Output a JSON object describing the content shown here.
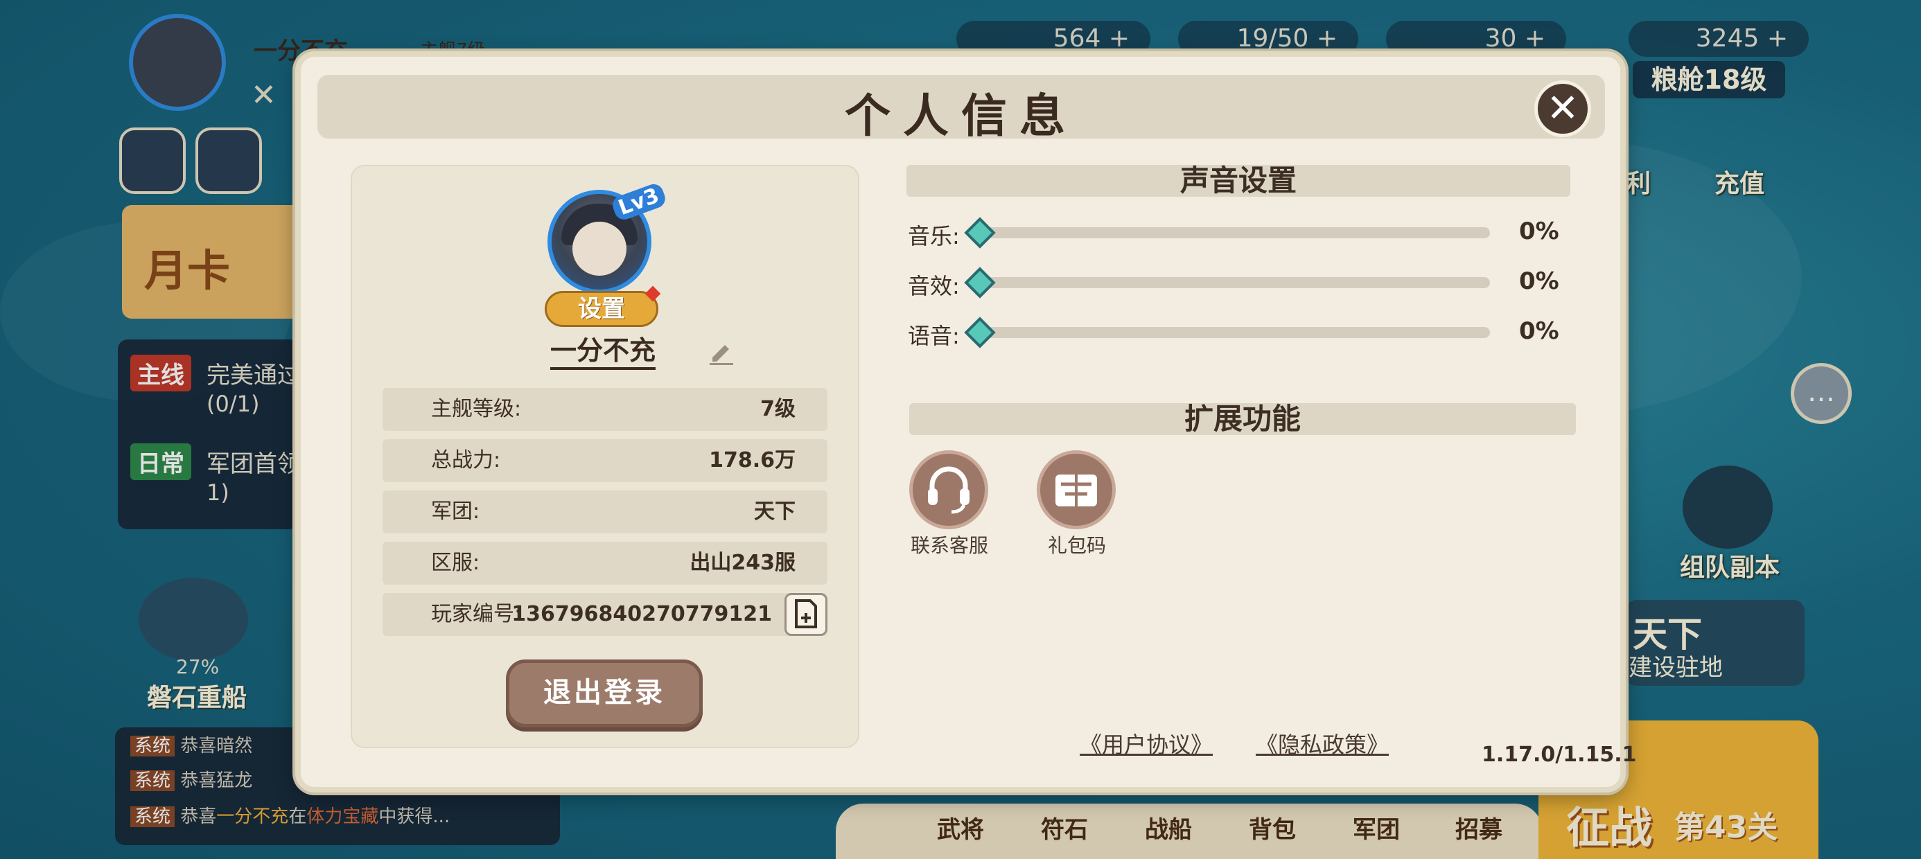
{
  "background": {
    "player_name": "一分不充",
    "rank_text": "主舰7级",
    "hud": {
      "coins": "564 +",
      "stamina": "19/50 +",
      "gold": "30 +",
      "grain": "3245 +",
      "granary": "粮舱18级"
    },
    "side_labels": {
      "welfare": "利",
      "recharge": "充值",
      "team_dungeon": "组队副本",
      "tianxia": "天下",
      "build_base": "建设驻地"
    },
    "month_card": "月卡",
    "quests": [
      {
        "tag": "主线",
        "text": "完美通过",
        "progress": "(0/1)"
      },
      {
        "tag": "日常",
        "text": "军团首领",
        "progress": "1)"
      }
    ],
    "ship": {
      "percent": "27%",
      "name": "磐石重船"
    },
    "chat": [
      {
        "tag": "系统",
        "text": "恭喜暗然"
      },
      {
        "tag": "系统",
        "text": "恭喜猛龙"
      },
      {
        "tag": "系统",
        "prefix": "恭喜",
        "name": "一分不充",
        "mid": "在",
        "place": "体力宝藏",
        "suffix": "中获得..."
      }
    ],
    "bottom_tabs": [
      "武将",
      "符石",
      "战船",
      "背包",
      "军团",
      "招募"
    ],
    "campaign": {
      "label": "征战",
      "stage": "第43关"
    }
  },
  "dialog": {
    "title": "个人信息",
    "close_symbol": "✕",
    "profile": {
      "lv_badge": "Lv3",
      "settings_label": "设置",
      "name": "一分不充"
    },
    "info_rows": [
      {
        "label": "主舰等级:",
        "value": "7级"
      },
      {
        "label": "总战力:",
        "value": "178.6万"
      },
      {
        "label": "军团:",
        "value": "天下"
      },
      {
        "label": "区服:",
        "value": "出山243服"
      },
      {
        "label": "玩家编号:",
        "value": "1367968402707791​21"
      }
    ],
    "logout_label": "退出登录",
    "sound": {
      "heading": "声音设置",
      "sliders": [
        {
          "label": "音乐:",
          "value": "0%",
          "level": 0
        },
        {
          "label": "音效:",
          "value": "0%",
          "level": 0
        },
        {
          "label": "语音:",
          "value": "0%",
          "level": 0
        }
      ]
    },
    "extensions": {
      "heading": "扩展功能",
      "items": [
        {
          "label": "联系客服",
          "icon": "headset-icon"
        },
        {
          "label": "礼包码",
          "icon": "gift-code-icon"
        }
      ]
    },
    "links": {
      "user_agreement": "《用户协议》",
      "privacy_policy": "《隐私政策》"
    },
    "version": "1.17.0/1.15.1"
  },
  "colors": {
    "dialog_bg": "#f2ede0",
    "row_bg": "#e0d8c7",
    "knob": "#58c8b8",
    "logout": "#9c7b6a",
    "settings_button": "#e5a93a"
  }
}
